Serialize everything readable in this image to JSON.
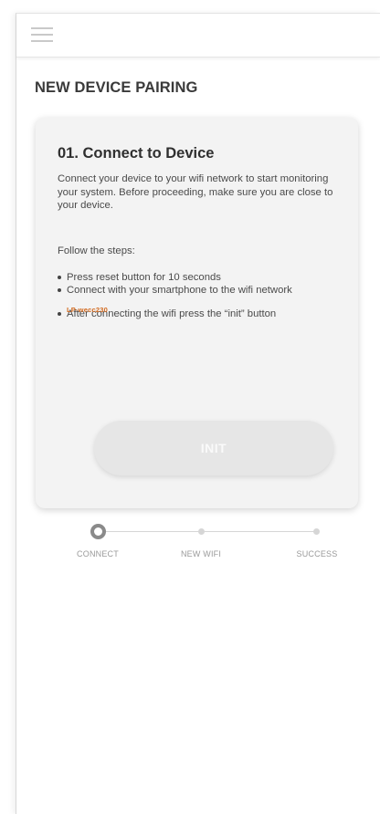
{
  "header": {
    "menu_icon": "hamburger-menu-icon"
  },
  "page": {
    "title": "NEW DEVICE PAIRING"
  },
  "card": {
    "title": "01. Connect to Device",
    "description": "Connect your device to your wifi network to start monitoring your system. Before proceeding, make sure you are close to your device.",
    "follow_label": "Follow the steps:",
    "steps": [
      "Press reset button for 10 seconds",
      "Connect with your smartphone to the wifi network",
      "After connecting the wifi press the “init” button"
    ],
    "network_name": "LP-wecc230",
    "network_color": "#d2691e",
    "init_button": "INIT"
  },
  "stepper": {
    "steps": [
      "CONNECT",
      "NEW WIFI",
      "SUCCESS"
    ],
    "active_step": "CONNECT"
  }
}
